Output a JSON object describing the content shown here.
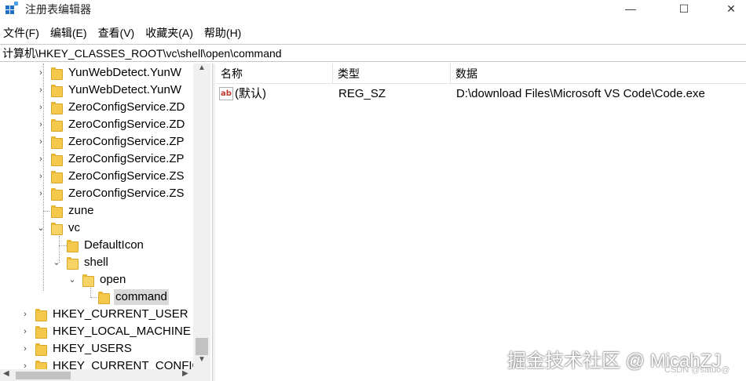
{
  "window": {
    "title": "注册表编辑器",
    "minimize_glyph": "—",
    "maximize_glyph": "☐",
    "close_glyph": "✕"
  },
  "menu": [
    "文件(F)",
    "编辑(E)",
    "查看(V)",
    "收藏夹(A)",
    "帮助(H)"
  ],
  "address": "计算机\\HKEY_CLASSES_ROOT\\vc\\shell\\open\\command",
  "tree": {
    "nodes": [
      {
        "label": "YunWebDetect.YunW",
        "expander": "›"
      },
      {
        "label": "YunWebDetect.YunW",
        "expander": "›"
      },
      {
        "label": "ZeroConfigService.ZD",
        "expander": "›"
      },
      {
        "label": "ZeroConfigService.ZD",
        "expander": "›"
      },
      {
        "label": "ZeroConfigService.ZP",
        "expander": "›"
      },
      {
        "label": "ZeroConfigService.ZP",
        "expander": "›"
      },
      {
        "label": "ZeroConfigService.ZS",
        "expander": "›"
      },
      {
        "label": "ZeroConfigService.ZS",
        "expander": "›"
      },
      {
        "label": "zune",
        "expander": ""
      },
      {
        "label": "vc",
        "expander": "⌄"
      },
      {
        "label": "DefaultIcon",
        "expander": ""
      },
      {
        "label": "shell",
        "expander": "⌄"
      },
      {
        "label": "open",
        "expander": "⌄"
      },
      {
        "label": "command",
        "expander": ""
      },
      {
        "label": "HKEY_CURRENT_USER",
        "expander": "›"
      },
      {
        "label": "HKEY_LOCAL_MACHINE",
        "expander": "›"
      },
      {
        "label": "HKEY_USERS",
        "expander": "›"
      },
      {
        "label": "HKEY_CURRENT_CONFIG",
        "expander": "›"
      }
    ]
  },
  "values_pane": {
    "columns": {
      "name": "名称",
      "type": "类型",
      "data": "数据"
    },
    "rows": [
      {
        "icon": "ab",
        "name": "(默认)",
        "type": "REG_SZ",
        "data": "D:\\download Files\\Microsoft VS Code\\Code.exe"
      }
    ]
  },
  "watermark": "掘金技术社区 @ MicahZJ",
  "csdn_mark": "CSDN @satuo@"
}
